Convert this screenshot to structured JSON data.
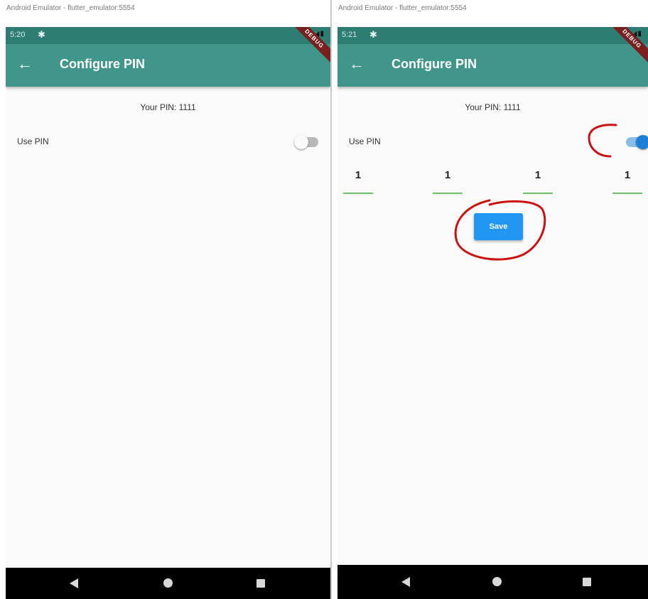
{
  "left": {
    "window_title": "Android Emulator - flutter_emulator:5554",
    "time": "5:20",
    "app_title": "Configure PIN",
    "debug_banner": "DEBUG",
    "pin_text": "Your PIN: 1111",
    "use_pin_label": "Use PIN",
    "use_pin_enabled": false
  },
  "right": {
    "window_title": "Android Emulator - flutter_emulator:5554",
    "time": "5:21",
    "app_title": "Configure PIN",
    "debug_banner": "DEBUG",
    "pin_text": "Your PIN: 1111",
    "use_pin_label": "Use PIN",
    "use_pin_enabled": true,
    "pin_digits": [
      "1",
      "1",
      "1",
      "1"
    ],
    "save_label": "Save"
  },
  "icons": {
    "back": "arrow-left-icon",
    "status_settings": "gear-icon",
    "status_wifi_signal_battery": "status-icons",
    "nav_back": "triangle-back-icon",
    "nav_home": "circle-home-icon",
    "nav_recent": "square-recent-icon"
  },
  "colors": {
    "status_bar": "#2e7d72",
    "app_bar": "#40968a",
    "switch_on_thumb": "#1e7fd6",
    "switch_on_track": "#8bbde9",
    "save_button": "#2196f3",
    "pin_underline": "#6cc26c",
    "annotation": "#cc1111"
  }
}
